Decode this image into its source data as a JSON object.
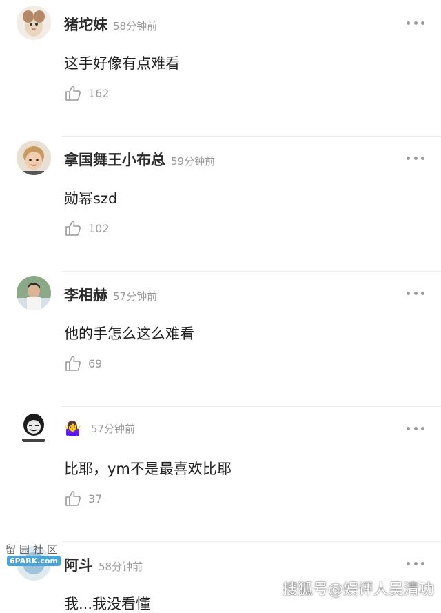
{
  "comments": [
    {
      "name": "猪坨妹",
      "time": "58分钟前",
      "text": "这手好像有点难看",
      "likes": "162"
    },
    {
      "name": "拿国舞王小布总",
      "time": "59分钟前",
      "text": "勋幂szd",
      "likes": "102"
    },
    {
      "name": "李相赫",
      "time": "57分钟前",
      "text": "他的手怎么这么难看",
      "likes": "69"
    },
    {
      "name": "🤷‍♀️",
      "time": "57分钟前",
      "text": "比耶，ym不是最喜欢比耶",
      "likes": "37"
    },
    {
      "name": "阿斗",
      "time": "58分钟前",
      "text": "我...我没看懂",
      "likes": ""
    }
  ],
  "watermarks": {
    "left_top": "留园社区",
    "left_bottom": "6PARK.com",
    "right": "搜狐号@娱评人吴清功"
  }
}
